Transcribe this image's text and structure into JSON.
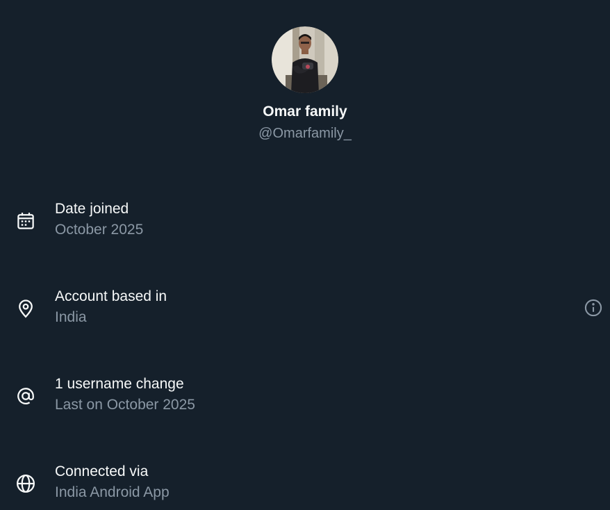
{
  "profile": {
    "display_name": "Omar family",
    "handle": "@Omarfamily_",
    "avatar": "profile-photo"
  },
  "details": [
    {
      "icon": "calendar-icon",
      "label": "Date joined",
      "value": "October 2025"
    },
    {
      "icon": "location-pin-icon",
      "label": "Account based in",
      "value": "India"
    },
    {
      "icon": "at-sign-icon",
      "label": "1 username change",
      "value": "Last on October 2025"
    },
    {
      "icon": "globe-icon",
      "label": "Connected via",
      "value": "India Android App"
    }
  ],
  "colors": {
    "background": "#15202b",
    "primary_text": "#f7f9f9",
    "secondary_text": "#8b98a5"
  }
}
